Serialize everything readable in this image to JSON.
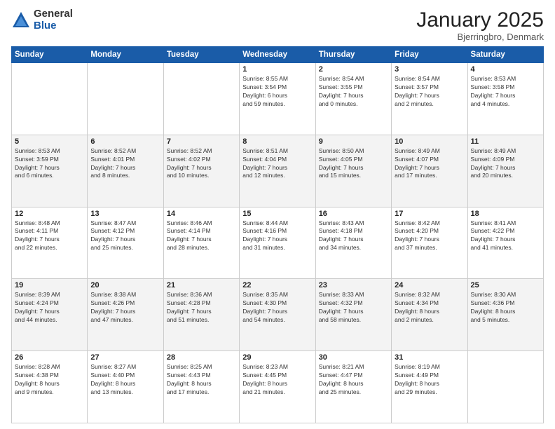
{
  "logo": {
    "general": "General",
    "blue": "Blue"
  },
  "title": "January 2025",
  "location": "Bjerringbro, Denmark",
  "weekdays": [
    "Sunday",
    "Monday",
    "Tuesday",
    "Wednesday",
    "Thursday",
    "Friday",
    "Saturday"
  ],
  "weeks": [
    [
      {
        "day": "",
        "info": ""
      },
      {
        "day": "",
        "info": ""
      },
      {
        "day": "",
        "info": ""
      },
      {
        "day": "1",
        "info": "Sunrise: 8:55 AM\nSunset: 3:54 PM\nDaylight: 6 hours\nand 59 minutes."
      },
      {
        "day": "2",
        "info": "Sunrise: 8:54 AM\nSunset: 3:55 PM\nDaylight: 7 hours\nand 0 minutes."
      },
      {
        "day": "3",
        "info": "Sunrise: 8:54 AM\nSunset: 3:57 PM\nDaylight: 7 hours\nand 2 minutes."
      },
      {
        "day": "4",
        "info": "Sunrise: 8:53 AM\nSunset: 3:58 PM\nDaylight: 7 hours\nand 4 minutes."
      }
    ],
    [
      {
        "day": "5",
        "info": "Sunrise: 8:53 AM\nSunset: 3:59 PM\nDaylight: 7 hours\nand 6 minutes."
      },
      {
        "day": "6",
        "info": "Sunrise: 8:52 AM\nSunset: 4:01 PM\nDaylight: 7 hours\nand 8 minutes."
      },
      {
        "day": "7",
        "info": "Sunrise: 8:52 AM\nSunset: 4:02 PM\nDaylight: 7 hours\nand 10 minutes."
      },
      {
        "day": "8",
        "info": "Sunrise: 8:51 AM\nSunset: 4:04 PM\nDaylight: 7 hours\nand 12 minutes."
      },
      {
        "day": "9",
        "info": "Sunrise: 8:50 AM\nSunset: 4:05 PM\nDaylight: 7 hours\nand 15 minutes."
      },
      {
        "day": "10",
        "info": "Sunrise: 8:49 AM\nSunset: 4:07 PM\nDaylight: 7 hours\nand 17 minutes."
      },
      {
        "day": "11",
        "info": "Sunrise: 8:49 AM\nSunset: 4:09 PM\nDaylight: 7 hours\nand 20 minutes."
      }
    ],
    [
      {
        "day": "12",
        "info": "Sunrise: 8:48 AM\nSunset: 4:11 PM\nDaylight: 7 hours\nand 22 minutes."
      },
      {
        "day": "13",
        "info": "Sunrise: 8:47 AM\nSunset: 4:12 PM\nDaylight: 7 hours\nand 25 minutes."
      },
      {
        "day": "14",
        "info": "Sunrise: 8:46 AM\nSunset: 4:14 PM\nDaylight: 7 hours\nand 28 minutes."
      },
      {
        "day": "15",
        "info": "Sunrise: 8:44 AM\nSunset: 4:16 PM\nDaylight: 7 hours\nand 31 minutes."
      },
      {
        "day": "16",
        "info": "Sunrise: 8:43 AM\nSunset: 4:18 PM\nDaylight: 7 hours\nand 34 minutes."
      },
      {
        "day": "17",
        "info": "Sunrise: 8:42 AM\nSunset: 4:20 PM\nDaylight: 7 hours\nand 37 minutes."
      },
      {
        "day": "18",
        "info": "Sunrise: 8:41 AM\nSunset: 4:22 PM\nDaylight: 7 hours\nand 41 minutes."
      }
    ],
    [
      {
        "day": "19",
        "info": "Sunrise: 8:39 AM\nSunset: 4:24 PM\nDaylight: 7 hours\nand 44 minutes."
      },
      {
        "day": "20",
        "info": "Sunrise: 8:38 AM\nSunset: 4:26 PM\nDaylight: 7 hours\nand 47 minutes."
      },
      {
        "day": "21",
        "info": "Sunrise: 8:36 AM\nSunset: 4:28 PM\nDaylight: 7 hours\nand 51 minutes."
      },
      {
        "day": "22",
        "info": "Sunrise: 8:35 AM\nSunset: 4:30 PM\nDaylight: 7 hours\nand 54 minutes."
      },
      {
        "day": "23",
        "info": "Sunrise: 8:33 AM\nSunset: 4:32 PM\nDaylight: 7 hours\nand 58 minutes."
      },
      {
        "day": "24",
        "info": "Sunrise: 8:32 AM\nSunset: 4:34 PM\nDaylight: 8 hours\nand 2 minutes."
      },
      {
        "day": "25",
        "info": "Sunrise: 8:30 AM\nSunset: 4:36 PM\nDaylight: 8 hours\nand 5 minutes."
      }
    ],
    [
      {
        "day": "26",
        "info": "Sunrise: 8:28 AM\nSunset: 4:38 PM\nDaylight: 8 hours\nand 9 minutes."
      },
      {
        "day": "27",
        "info": "Sunrise: 8:27 AM\nSunset: 4:40 PM\nDaylight: 8 hours\nand 13 minutes."
      },
      {
        "day": "28",
        "info": "Sunrise: 8:25 AM\nSunset: 4:43 PM\nDaylight: 8 hours\nand 17 minutes."
      },
      {
        "day": "29",
        "info": "Sunrise: 8:23 AM\nSunset: 4:45 PM\nDaylight: 8 hours\nand 21 minutes."
      },
      {
        "day": "30",
        "info": "Sunrise: 8:21 AM\nSunset: 4:47 PM\nDaylight: 8 hours\nand 25 minutes."
      },
      {
        "day": "31",
        "info": "Sunrise: 8:19 AM\nSunset: 4:49 PM\nDaylight: 8 hours\nand 29 minutes."
      },
      {
        "day": "",
        "info": ""
      }
    ]
  ]
}
